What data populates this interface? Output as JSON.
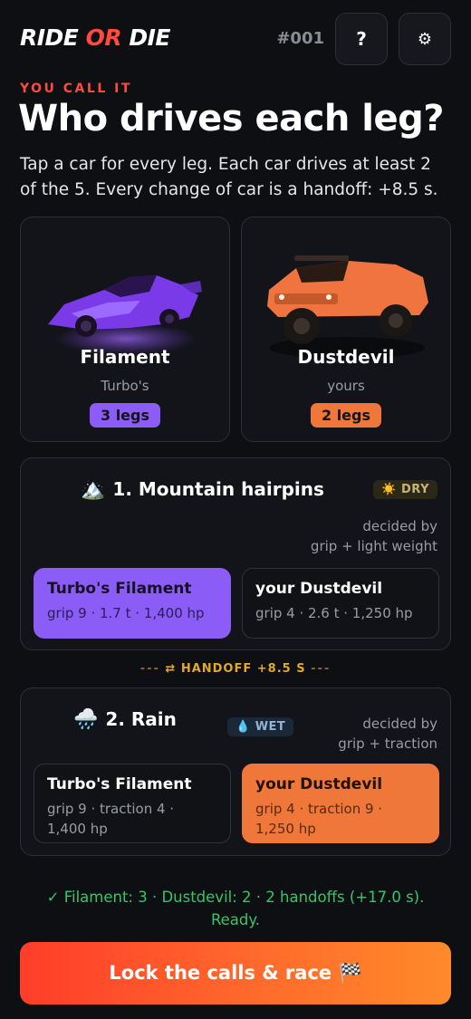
{
  "header": {
    "logo_part1": "RIDE ",
    "logo_part2": "OR",
    "logo_part3": " DIE",
    "puzzle_number": "#001",
    "help_label": "?",
    "settings_label": "⚙"
  },
  "intro": {
    "eyebrow": "YOU CALL IT",
    "headline": "Who drives each leg?",
    "description": "Tap a car for every leg. Each car drives at least 2 of the 5. Every change of car is a handoff: +8.5 s."
  },
  "cars": [
    {
      "name": "Filament",
      "owner": "Turbo's",
      "legs": "3 legs",
      "color": "#8b5cf6"
    },
    {
      "name": "Dustdevil",
      "owner": "yours",
      "legs": "2 legs",
      "color": "#f0773a"
    }
  ],
  "legs": [
    {
      "emoji": "🏔️",
      "title": "1. Mountain hairpins",
      "condition": "☀️ DRY",
      "decided_by_label": "decided by",
      "decided_by": "grip + light weight",
      "choices": [
        {
          "name": "Turbo's Filament",
          "stats": "grip 9 · 1.7 t · 1,400 hp",
          "selected": true
        },
        {
          "name": "your Dustdevil",
          "stats": "grip 4 · 2.6 t · 1,250 hp",
          "selected": false
        }
      ]
    },
    {
      "emoji": "🌧️",
      "title": "2. Rain",
      "condition": "💧 WET",
      "decided_by_label": "decided by",
      "decided_by": "grip + traction",
      "choices": [
        {
          "name": "Turbo's Filament",
          "stats_line1": "grip 9 · traction 4 ·",
          "stats_line2": "1,400 hp",
          "selected": false
        },
        {
          "name": "your Dustdevil",
          "stats_line1": "grip 4 · traction 9 ·",
          "stats_line2": "1,250 hp",
          "selected": true
        }
      ]
    }
  ],
  "handoff": {
    "dashes": "---",
    "label": "⇄ HANDOFF +8.5 S"
  },
  "status": "✓ Filament: 3 · Dustdevil: 2 · 2 handoffs (+17.0 s). Ready.",
  "cta": "Lock the calls & race 🏁"
}
